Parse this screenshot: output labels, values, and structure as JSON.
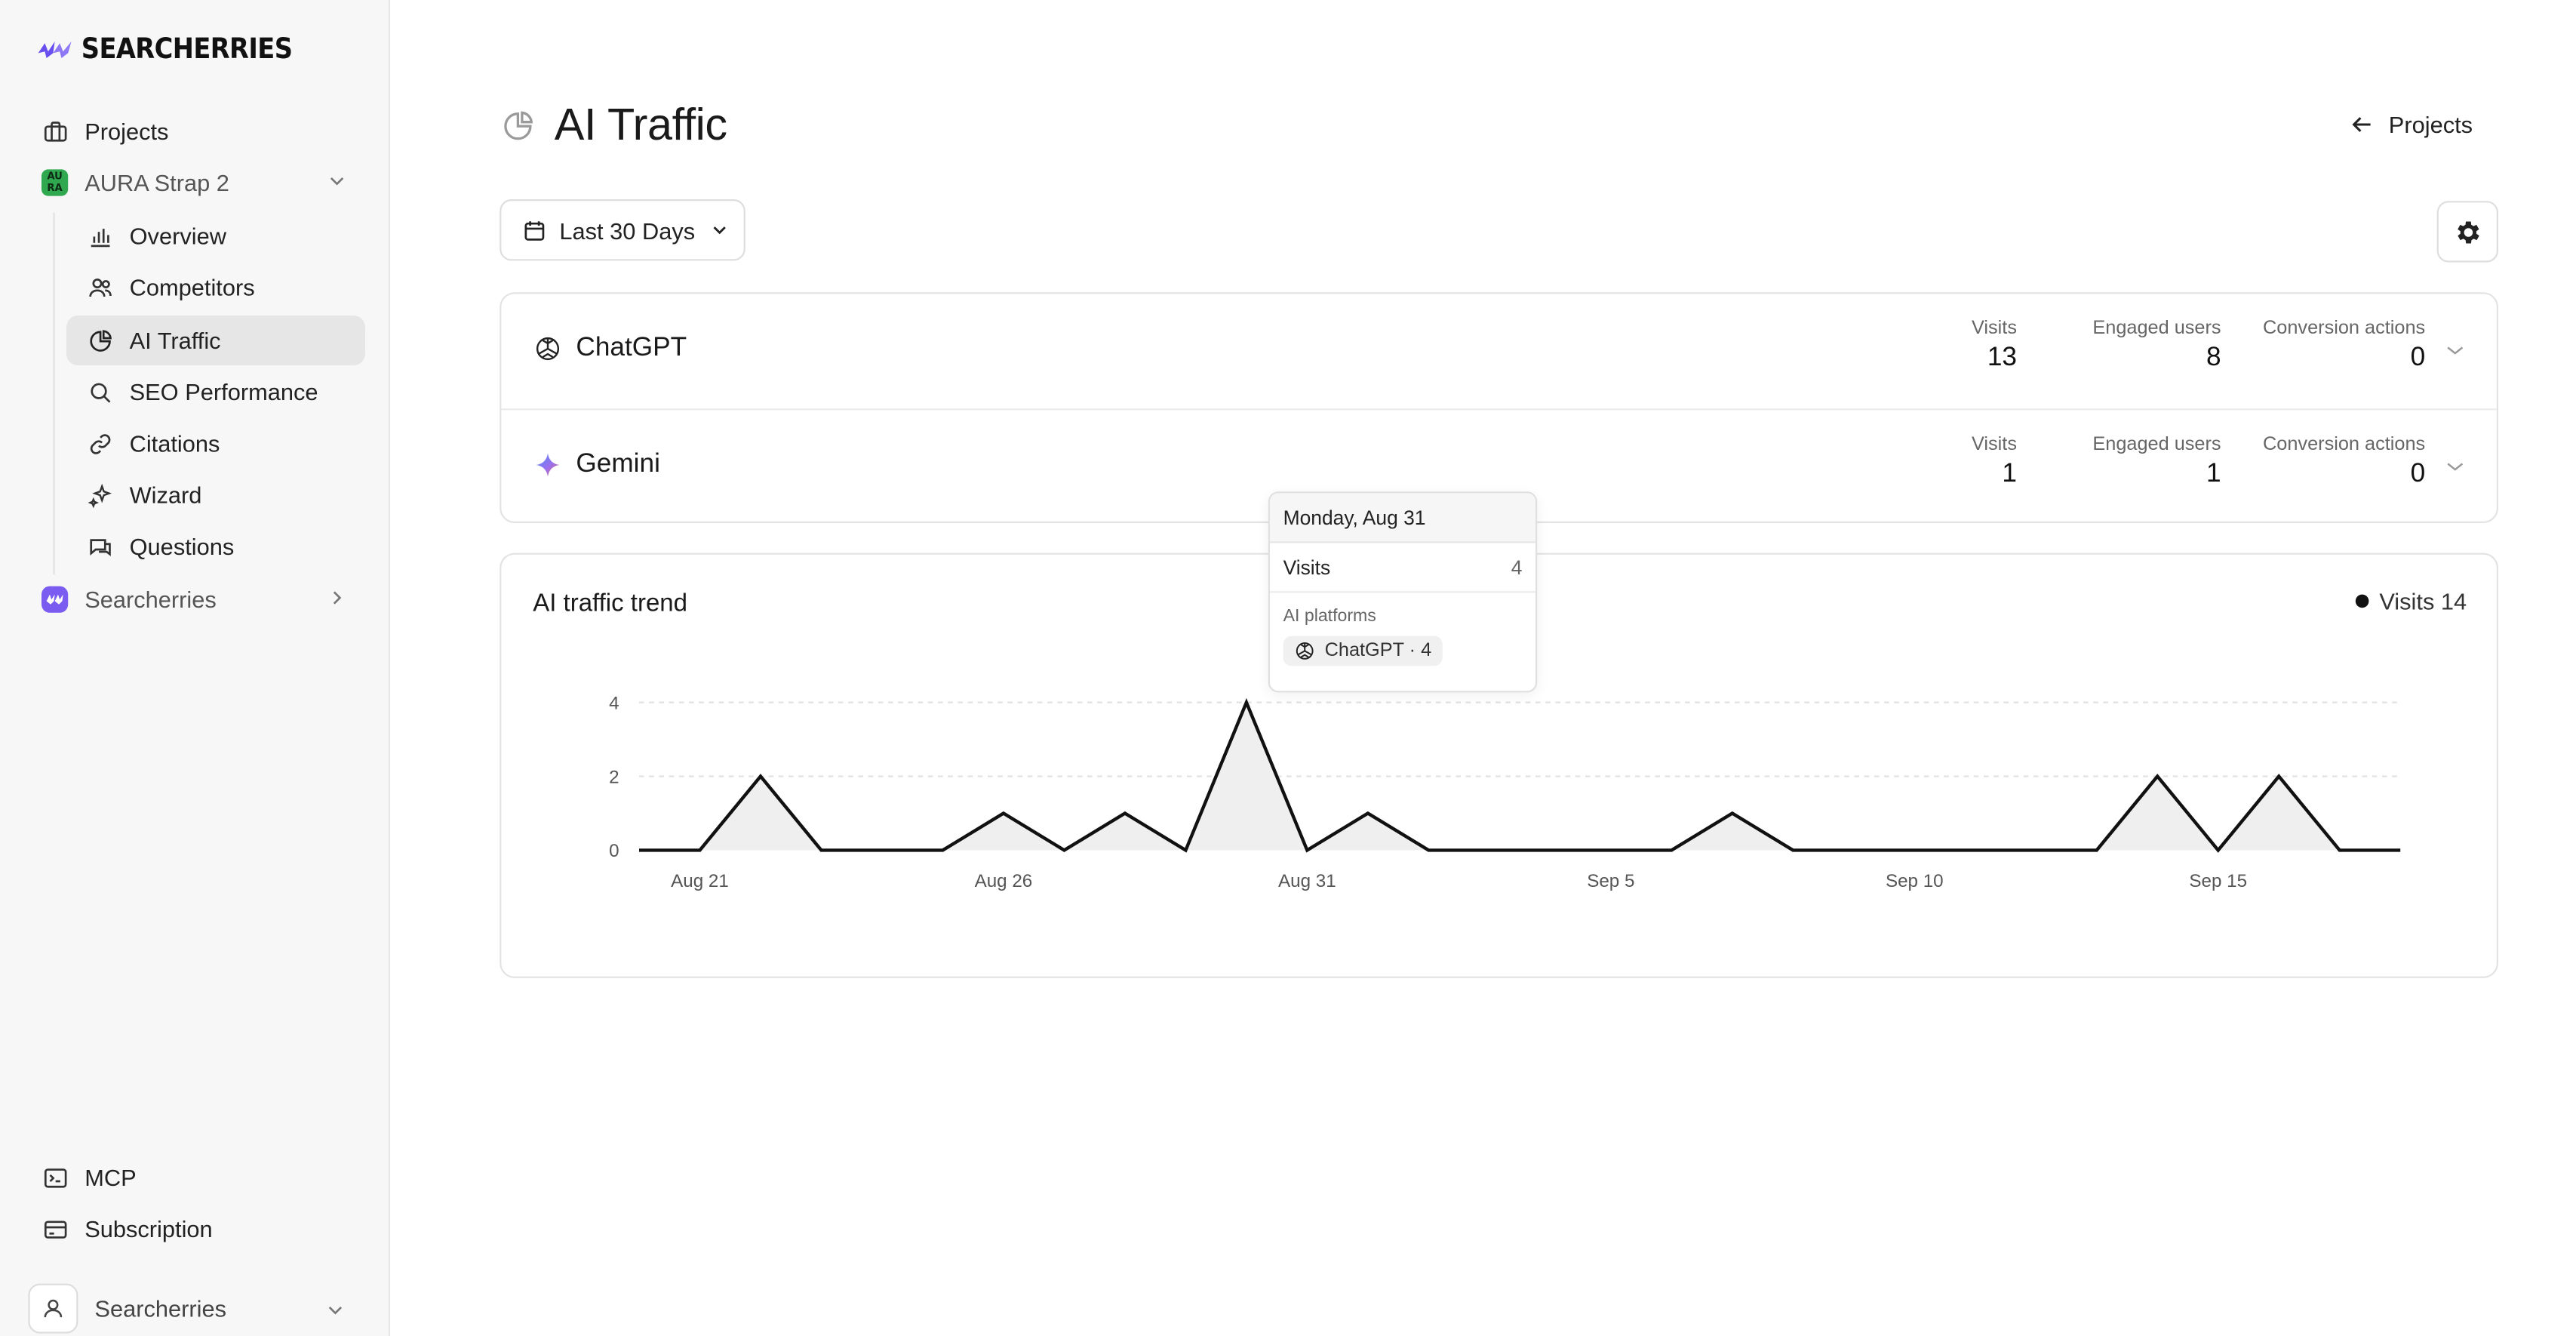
{
  "brand": {
    "name": "SEARCHERRIES",
    "accent": "#6a4ff0"
  },
  "sidebar": {
    "projects_label": "Projects",
    "project": {
      "name": "AURA Strap 2",
      "badge": "AU RA",
      "badge_color": "#2fa84f"
    },
    "sub_items": [
      {
        "label": "Overview",
        "icon": "bar-chart-icon"
      },
      {
        "label": "Competitors",
        "icon": "users-icon"
      },
      {
        "label": "AI Traffic",
        "icon": "pie-chart-icon",
        "active": true
      },
      {
        "label": "SEO Performance",
        "icon": "search-icon"
      },
      {
        "label": "Citations",
        "icon": "link-icon"
      },
      {
        "label": "Wizard",
        "icon": "sparkles-icon"
      },
      {
        "label": "Questions",
        "icon": "chat-icon"
      }
    ],
    "other_project": "Searcherries",
    "bottom": [
      {
        "label": "MCP",
        "icon": "terminal-icon"
      },
      {
        "label": "Subscription",
        "icon": "credit-card-icon"
      }
    ],
    "user": "Searcherries"
  },
  "header": {
    "title": "AI Traffic",
    "back_label": "Projects"
  },
  "filters": {
    "date_range": "Last 30 Days"
  },
  "platforms": [
    {
      "name": "ChatGPT",
      "icon": "openai-icon",
      "visits_label": "Visits",
      "visits": "13",
      "engaged_label": "Engaged users",
      "engaged": "8",
      "conversion_label": "Conversion actions",
      "conversions": "0"
    },
    {
      "name": "Gemini",
      "icon": "gemini-icon",
      "visits_label": "Visits",
      "visits": "1",
      "engaged_label": "Engaged users",
      "engaged": "1",
      "conversion_label": "Conversion actions",
      "conversions": "0"
    }
  ],
  "trend": {
    "title": "AI traffic trend",
    "legend": "Visits 14"
  },
  "tooltip": {
    "date": "Monday, Aug 31",
    "metric_label": "Visits",
    "metric_value": "4",
    "section": "AI platforms",
    "pill": "ChatGPT · 4"
  },
  "chart_data": {
    "type": "area",
    "x": [
      "Aug 20",
      "Aug 21",
      "Aug 22",
      "Aug 23",
      "Aug 24",
      "Aug 25",
      "Aug 26",
      "Aug 27",
      "Aug 28",
      "Aug 29",
      "Aug 30",
      "Aug 31",
      "Sep 1",
      "Sep 2",
      "Sep 3",
      "Sep 4",
      "Sep 5",
      "Sep 6",
      "Sep 7",
      "Sep 8",
      "Sep 9",
      "Sep 10",
      "Sep 11",
      "Sep 12",
      "Sep 13",
      "Sep 14",
      "Sep 15",
      "Sep 16",
      "Sep 17",
      "Sep 18"
    ],
    "series": [
      {
        "name": "Visits",
        "values": [
          0,
          0,
          2,
          0,
          0,
          0,
          1,
          0,
          1,
          0,
          4,
          0,
          1,
          0,
          0,
          0,
          0,
          0,
          1,
          0,
          0,
          0,
          0,
          0,
          0,
          2,
          0,
          2,
          0,
          0
        ]
      }
    ],
    "x_ticks": [
      "Aug 21",
      "Aug 26",
      "Aug 31",
      "Sep 5",
      "Sep 10",
      "Sep 15"
    ],
    "y_ticks": [
      "0",
      "2",
      "4"
    ],
    "ylim": [
      0,
      4
    ],
    "highlight": "Aug 31",
    "grid": true
  }
}
